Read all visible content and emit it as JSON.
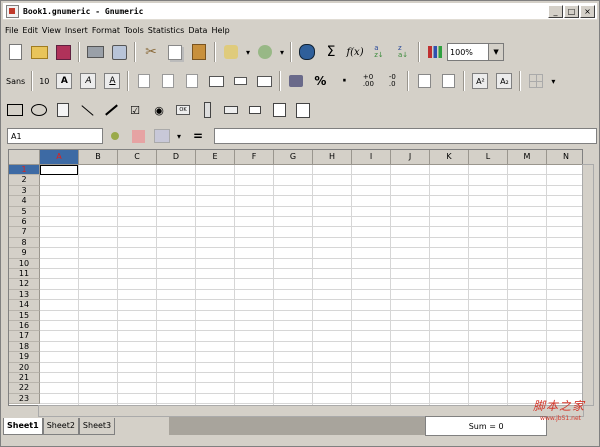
{
  "window": {
    "title": "Book1.gnumeric - Gnumeric",
    "controls": [
      "_",
      "□",
      "×"
    ]
  },
  "menu": [
    "File",
    "Edit",
    "View",
    "Insert",
    "Format",
    "Tools",
    "Statistics",
    "Data",
    "Help"
  ],
  "toolbar": {
    "zoom": "100%",
    "zoom_arrow": "▼"
  },
  "format_toolbar": {
    "font": "Sans",
    "size": "10",
    "bold": "A",
    "italic": "A",
    "underline": "A",
    "percent": "%",
    "dot": "·",
    "superscript": "A²",
    "subscript": "A₂"
  },
  "entry": {
    "cell": "A1",
    "equals": "="
  },
  "columns": [
    "A",
    "B",
    "C",
    "D",
    "E",
    "F",
    "G",
    "H",
    "I",
    "J",
    "K",
    "L",
    "M",
    "N"
  ],
  "rows": [
    "1",
    "2",
    "3",
    "4",
    "5",
    "6",
    "7",
    "8",
    "9",
    "10",
    "11",
    "12",
    "13",
    "14",
    "15",
    "16",
    "17",
    "18",
    "19",
    "20",
    "21",
    "22",
    "23"
  ],
  "sheets": [
    "Sheet1",
    "Sheet2",
    "Sheet3"
  ],
  "status": {
    "sum": "Sum = 0"
  },
  "watermark": {
    "main": "脚本之家",
    "sub": "www.jb51.net"
  }
}
